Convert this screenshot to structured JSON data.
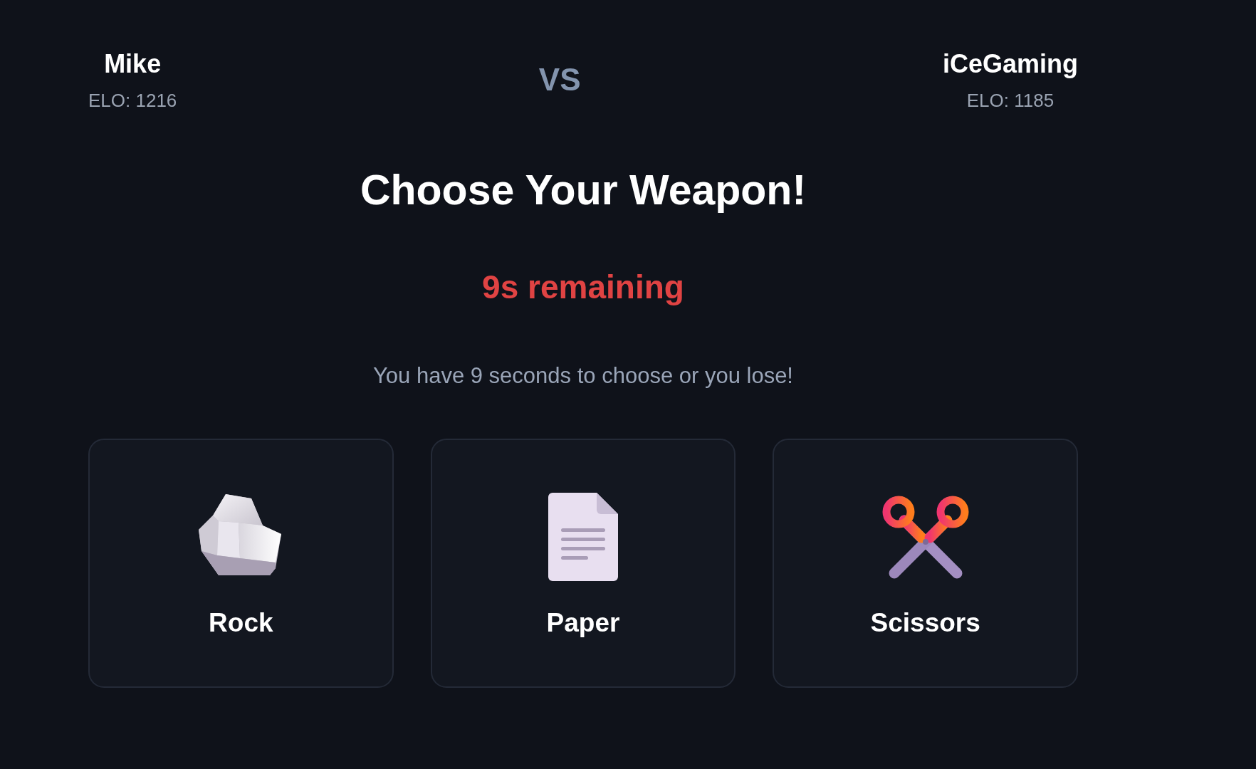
{
  "players": [
    {
      "name": "Mike",
      "elo": "ELO: 1216"
    },
    {
      "name": "iCeGaming",
      "elo": "ELO: 1185"
    }
  ],
  "versus": "VS",
  "heading": "Choose Your Weapon!",
  "timer": "9s remaining",
  "notice": "You have 9 seconds to choose or you lose!",
  "weapons": [
    {
      "kind": "rock",
      "label": "Rock"
    },
    {
      "kind": "paper",
      "label": "Paper"
    },
    {
      "kind": "scissors",
      "label": "Scissors"
    }
  ]
}
